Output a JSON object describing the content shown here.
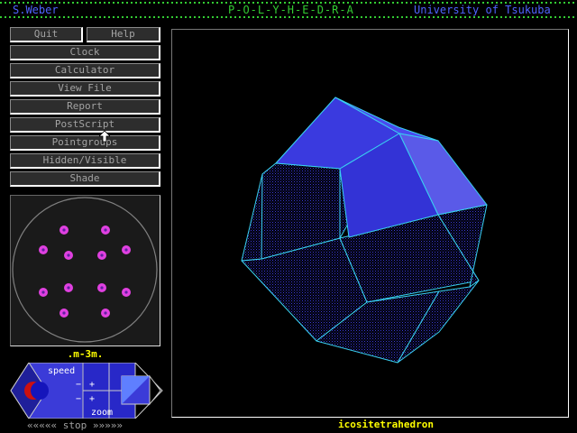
{
  "header": {
    "author": "S.Weber",
    "app_title": "P-O-L-Y-H-E-D-R-A",
    "institution": "University of Tsukuba"
  },
  "menu": {
    "quit": "Quit",
    "help": "Help",
    "clock": "Clock",
    "calculator": "Calculator",
    "view_file": "View File",
    "report": "Report",
    "postscript": "PostScript",
    "pointgroups": "Pointgroups",
    "hidden_visible": "Hidden/Visible",
    "shade": "Shade"
  },
  "pointgroup": {
    "symbol": ".m-3m."
  },
  "controls": {
    "speed_label": "speed",
    "zoom_label": "zoom",
    "minus": "−",
    "plus": "+",
    "stop_label": "««««« stop »»»»»"
  },
  "viewer": {
    "polyhedron_name": "icositetrahedron"
  },
  "colors": {
    "face": "#3a3adf",
    "edge": "#39d0f0",
    "dot": "#e040e0",
    "accent_green": "#33cc33",
    "label_yellow": "#ffff00"
  }
}
